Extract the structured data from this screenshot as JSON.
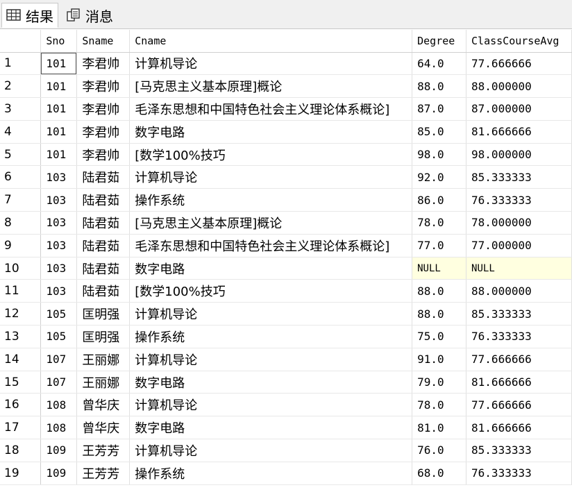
{
  "tabs": [
    {
      "label": "结果",
      "icon": "grid-icon",
      "active": true
    },
    {
      "label": "消息",
      "icon": "messages-icon",
      "active": false
    }
  ],
  "columns": [
    "",
    "Sno",
    "Sname",
    "Cname",
    "Degree",
    "ClassCourseAvg"
  ],
  "rows": [
    {
      "num": "1",
      "sno": "101",
      "sname": "李君帅",
      "cname": "计算机导论",
      "degree": "64.0",
      "avg": "77.666666"
    },
    {
      "num": "2",
      "sno": "101",
      "sname": "李君帅",
      "cname": "[马克思主义基本原理]概论",
      "degree": "88.0",
      "avg": "88.000000"
    },
    {
      "num": "3",
      "sno": "101",
      "sname": "李君帅",
      "cname": "毛泽东思想和中国特色社会主义理论体系概论]",
      "degree": "87.0",
      "avg": "87.000000"
    },
    {
      "num": "4",
      "sno": "101",
      "sname": "李君帅",
      "cname": "数字电路",
      "degree": "85.0",
      "avg": "81.666666"
    },
    {
      "num": "5",
      "sno": "101",
      "sname": "李君帅",
      "cname": "[数学100%技巧",
      "degree": "98.0",
      "avg": "98.000000"
    },
    {
      "num": "6",
      "sno": "103",
      "sname": "陆君茹",
      "cname": "计算机导论",
      "degree": "92.0",
      "avg": "85.333333"
    },
    {
      "num": "7",
      "sno": "103",
      "sname": "陆君茹",
      "cname": "操作系统",
      "degree": "86.0",
      "avg": "76.333333"
    },
    {
      "num": "8",
      "sno": "103",
      "sname": "陆君茹",
      "cname": "[马克思主义基本原理]概论",
      "degree": "78.0",
      "avg": "78.000000"
    },
    {
      "num": "9",
      "sno": "103",
      "sname": "陆君茹",
      "cname": "毛泽东思想和中国特色社会主义理论体系概论]",
      "degree": "77.0",
      "avg": "77.000000"
    },
    {
      "num": "10",
      "sno": "103",
      "sname": "陆君茹",
      "cname": "数字电路",
      "degree": "NULL",
      "avg": "NULL"
    },
    {
      "num": "11",
      "sno": "103",
      "sname": "陆君茹",
      "cname": "[数学100%技巧",
      "degree": "88.0",
      "avg": "88.000000"
    },
    {
      "num": "12",
      "sno": "105",
      "sname": "匡明强",
      "cname": "计算机导论",
      "degree": "88.0",
      "avg": "85.333333"
    },
    {
      "num": "13",
      "sno": "105",
      "sname": "匡明强",
      "cname": "操作系统",
      "degree": "75.0",
      "avg": "76.333333"
    },
    {
      "num": "14",
      "sno": "107",
      "sname": "王丽娜",
      "cname": "计算机导论",
      "degree": "91.0",
      "avg": "77.666666"
    },
    {
      "num": "15",
      "sno": "107",
      "sname": "王丽娜",
      "cname": "数字电路",
      "degree": "79.0",
      "avg": "81.666666"
    },
    {
      "num": "16",
      "sno": "108",
      "sname": "曾华庆",
      "cname": "计算机导论",
      "degree": "78.0",
      "avg": "77.666666"
    },
    {
      "num": "17",
      "sno": "108",
      "sname": "曾华庆",
      "cname": "数字电路",
      "degree": "81.0",
      "avg": "81.666666"
    },
    {
      "num": "18",
      "sno": "109",
      "sname": "王芳芳",
      "cname": "计算机导论",
      "degree": "76.0",
      "avg": "85.333333"
    },
    {
      "num": "19",
      "sno": "109",
      "sname": "王芳芳",
      "cname": "操作系统",
      "degree": "68.0",
      "avg": "76.333333"
    }
  ],
  "colors": {
    "null_highlight": "#ffffe0",
    "tabbar": "#f0f0f0"
  }
}
